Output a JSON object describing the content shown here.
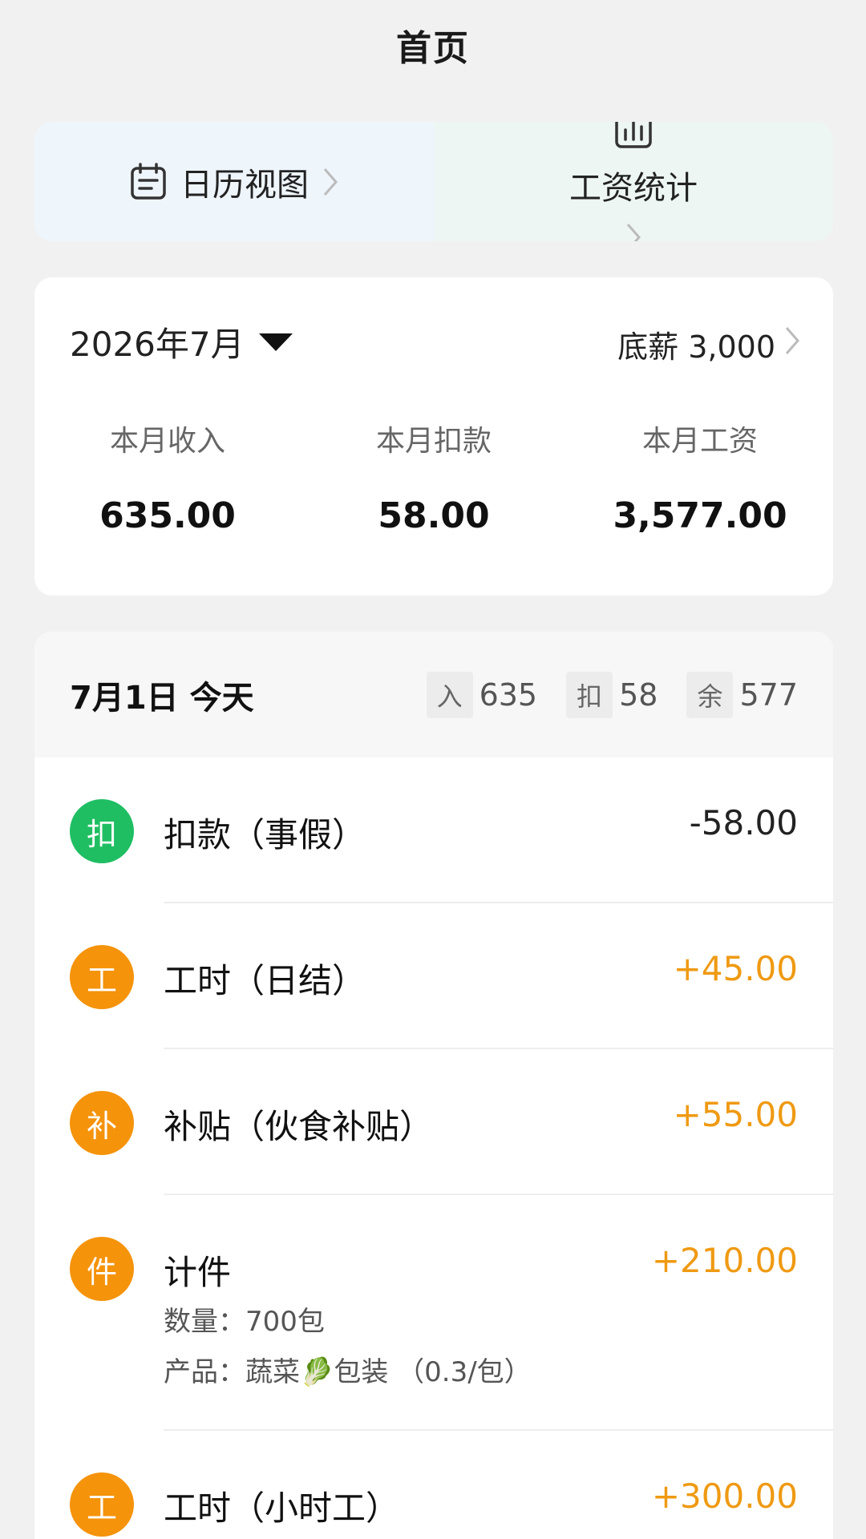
{
  "header": {
    "title": "首页"
  },
  "shortcuts": {
    "calendar_label": "日历视图",
    "stats_label": "工资统计"
  },
  "summary": {
    "month": "2026年7月",
    "base_salary": "底薪 3,000",
    "income_label": "本月收入",
    "income_value": "635.00",
    "deduction_label": "本月扣款",
    "deduction_value": "58.00",
    "salary_label": "本月工资",
    "salary_value": "3,577.00"
  },
  "day": {
    "title": "7月1日 今天",
    "income_tag": "入",
    "income_total": "635",
    "deduction_tag": "扣",
    "deduction_total": "58",
    "balance_tag": "余",
    "balance_total": "577"
  },
  "entries": [
    {
      "icon_char": "扣",
      "title": "扣款（事假）",
      "amount": "-58.00",
      "color": "#1fbe63"
    },
    {
      "icon_char": "工",
      "title": "工时（日结）",
      "amount": "+45.00",
      "color": "#f5930b"
    },
    {
      "icon_char": "补",
      "title": "补贴（伙食补贴）",
      "amount": "+55.00",
      "color": "#f5930b"
    },
    {
      "icon_char": "件",
      "title": "计件",
      "amount": "+210.00",
      "detail_quantity": "数量：700包",
      "detail_product": "产品：蔬菜🥬包装 （0.3/包）",
      "color": "#f5930b"
    },
    {
      "icon_char": "工",
      "title": "工时（小时工）",
      "amount": "+300.00",
      "color": "#f5930b"
    }
  ],
  "colors": {
    "deduction_green": "#1fbe63",
    "income_orange": "#f5930b",
    "positive_amount": "#ef9a13"
  }
}
